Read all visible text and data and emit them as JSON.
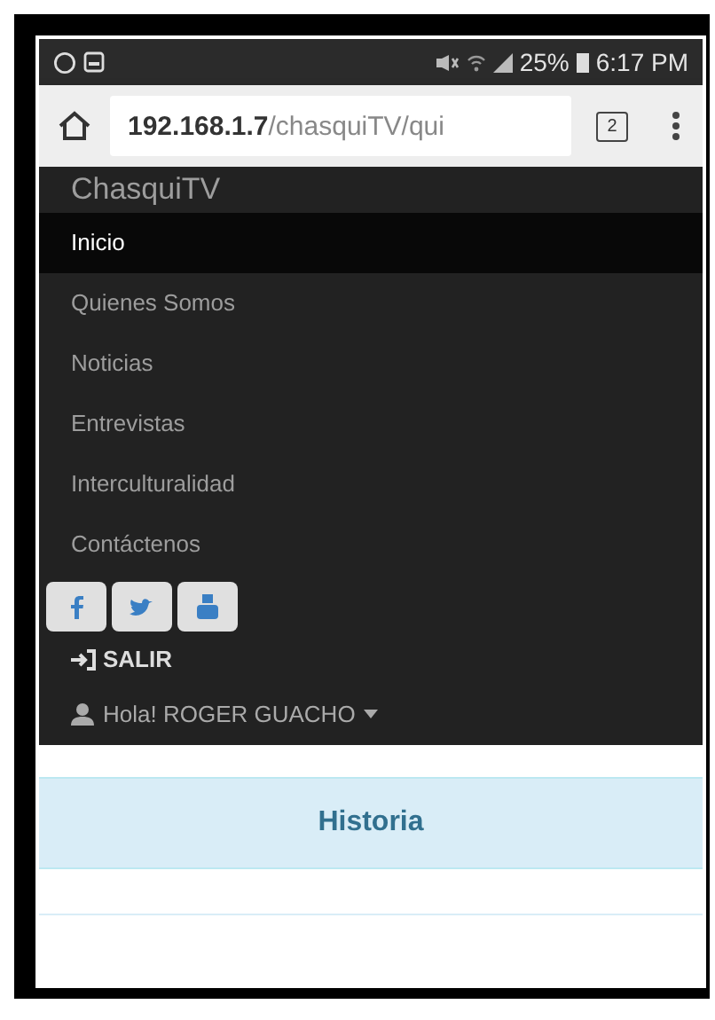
{
  "status_bar": {
    "battery": "25%",
    "time": "6:17 PM"
  },
  "browser": {
    "url_host": "192.168.1.7",
    "url_path": "/chasquiTV/qui",
    "tab_count": "2"
  },
  "brand": "ChasquiTV",
  "menu": [
    {
      "label": "Inicio",
      "selected": true
    },
    {
      "label": "Quienes Somos",
      "selected": false
    },
    {
      "label": "Noticias",
      "selected": false
    },
    {
      "label": "Entrevistas",
      "selected": false
    },
    {
      "label": "Interculturalidad",
      "selected": false
    },
    {
      "label": "Contáctenos",
      "selected": false
    }
  ],
  "social": [
    {
      "kind": "facebook"
    },
    {
      "kind": "twitter"
    },
    {
      "kind": "youtube"
    }
  ],
  "logout": "SALIR",
  "user_menu": "Hola! ROGER GUACHO",
  "panel": {
    "title": "Historia"
  }
}
